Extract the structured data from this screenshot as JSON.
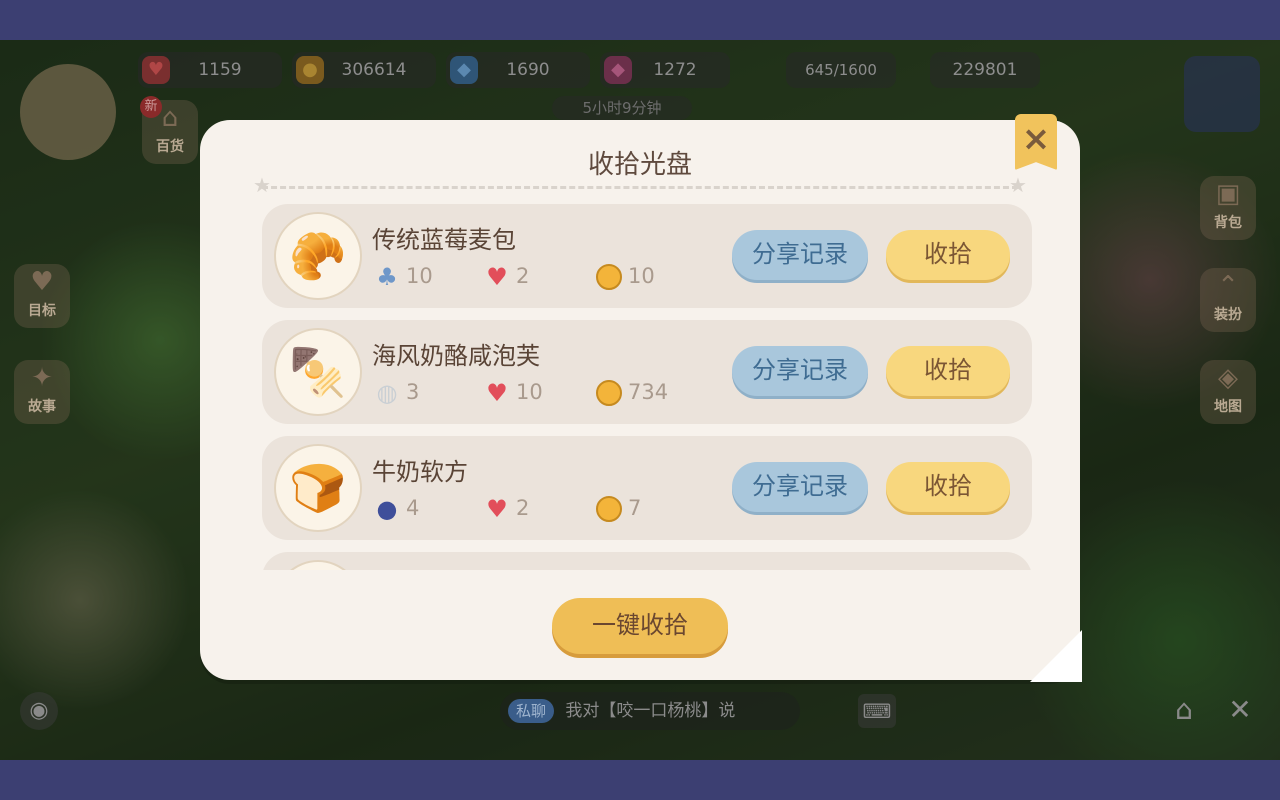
{
  "hud": {
    "hearts": "1159",
    "coins": "306614",
    "gems": "1690",
    "crystals": "1272",
    "exp": "645/1600",
    "score": "229801",
    "timer": "5小时9分钟"
  },
  "left_menu": [
    "百货",
    "目标",
    "故事"
  ],
  "right_menu": [
    "背包",
    "装扮",
    "地图"
  ],
  "new_badge": "新",
  "modal": {
    "title": "收拾光盘",
    "close_icon": "×",
    "share_label": "分享记录",
    "collect_label": "收拾",
    "collect_all_label": "一键收拾",
    "items": [
      {
        "name": "传统蓝莓麦包",
        "ingredient_icon": "mushroom-icon",
        "ingredient_count": "10",
        "hearts": "2",
        "coins": "10"
      },
      {
        "name": "海风奶酪咸泡芙",
        "ingredient_icon": "shell-icon",
        "ingredient_count": "3",
        "hearts": "10",
        "coins": "734"
      },
      {
        "name": "牛奶软方",
        "ingredient_icon": "blueberry-icon",
        "ingredient_count": "4",
        "hearts": "2",
        "coins": "7"
      }
    ]
  },
  "chat": {
    "tag": "私聊",
    "message": "我对【咬一口杨桃】说"
  }
}
